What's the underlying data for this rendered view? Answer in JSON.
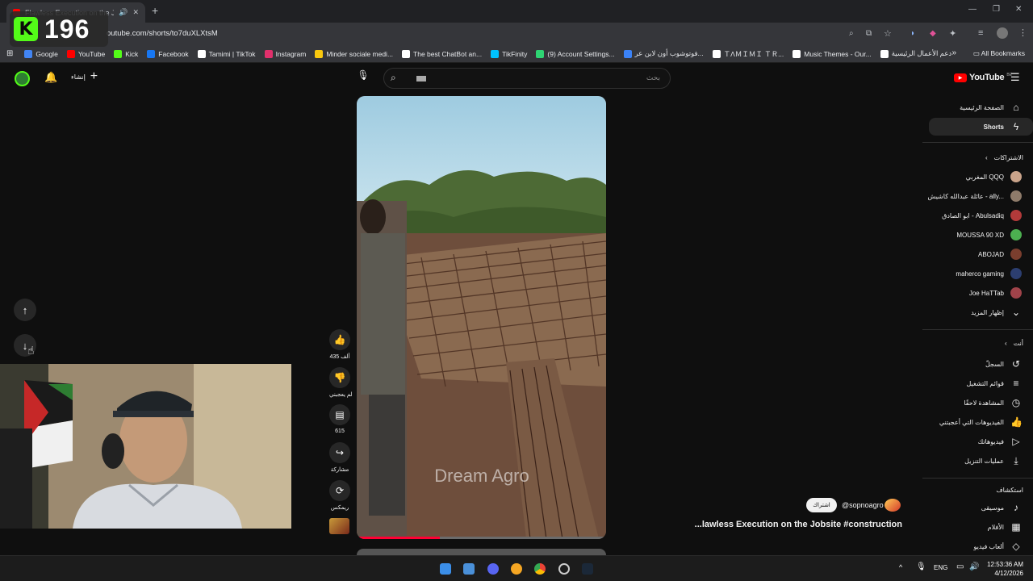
{
  "browser": {
    "tab_title": "Flawless Execution on the Jo",
    "url": "outube.com/shorts/to7duXLXtsM",
    "bookmarks": [
      {
        "label": "Google",
        "color": "#4285f4"
      },
      {
        "label": "YouTube",
        "color": "#ff0000"
      },
      {
        "label": "Kick",
        "color": "#53fc18"
      },
      {
        "label": "Facebook",
        "color": "#1877f2"
      },
      {
        "label": "Tamimi | TikTok",
        "color": "#ffffff"
      },
      {
        "label": "Instagram",
        "color": "#e1306c"
      },
      {
        "label": "Minder sociale medi...",
        "color": "#f9c80e"
      },
      {
        "label": "The best ChatBot an...",
        "color": "#ffffff"
      },
      {
        "label": "TikFinity",
        "color": "#00c2ff"
      },
      {
        "label": "(9) Account Settings...",
        "color": "#2ed573"
      },
      {
        "label": "فوتوشوب أون لاين عر...",
        "color": "#3b82f6"
      },
      {
        "label": "ＴΛＭＩＭＩ ＴＲ...",
        "color": "#ffffff"
      },
      {
        "label": "Music Themes - Our...",
        "color": "#ffffff"
      },
      {
        "label": "دعم الأعمال الرئيسية",
        "color": "#ffffff"
      }
    ],
    "all_bookmarks": "All Bookmarks"
  },
  "overlay": {
    "kick_logo": "K",
    "viewer_count": "196"
  },
  "header": {
    "create_label": "إنشاء",
    "search_placeholder": "بحث",
    "logo_text": "YouTube",
    "logo_region": "BE"
  },
  "sidebar": {
    "home": "الصفحة الرئيسية",
    "shorts": "Shorts",
    "subscriptions_heading": "الاشتراكات",
    "subscriptions": [
      {
        "name": "المغربي QQQ",
        "color": "#c9a38a"
      },
      {
        "name": "عائلة عبدالله كاشيش - ally...",
        "color": "#8e7b6a"
      },
      {
        "name": "ابو الصادق - Abulsadiq",
        "color": "#b23a3a"
      },
      {
        "name": "MOUSSA 90 XD",
        "color": "#4caf50"
      },
      {
        "name": "ABOJAD",
        "color": "#7a3e2e"
      },
      {
        "name": "maherco gaming",
        "color": "#2c3e70"
      },
      {
        "name": "Joe HaTTab",
        "color": "#a0434a"
      }
    ],
    "show_more": "إظهار المزيد",
    "you_heading": "أنت",
    "you_items": [
      "السجلّ",
      "قوائم التشغيل",
      "المشاهدة لاحقًا",
      "الفيديوهات التي أعجبتني",
      "فيديوهاتك",
      "عمليات التنزيل"
    ],
    "explore_heading": "استكشاف",
    "explore_items": [
      "موسيقى",
      "الأفلام",
      "ألعاب فيديو"
    ]
  },
  "video": {
    "watermark": "Dream Agro"
  },
  "actions": {
    "likes": "435 ألف",
    "dislike_label": "لم يعجبني",
    "comments": "615",
    "share_label": "مشاركة",
    "remix_label": "ريمكس"
  },
  "channel": {
    "handle": "@sopnoagro",
    "subscribe_label": "اشتراك",
    "video_title": "...lawless Execution on the Jobsite #construction"
  },
  "taskbar": {
    "language": "ENG",
    "time": "12:53:36 AM",
    "date": "4/12/2026"
  }
}
